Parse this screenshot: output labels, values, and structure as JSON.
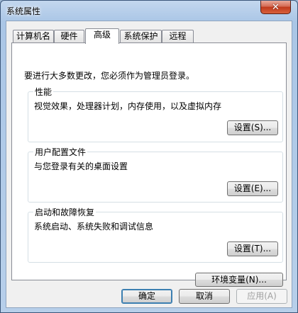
{
  "window": {
    "title": "系统属性"
  },
  "tabs": [
    {
      "label": "计算机名"
    },
    {
      "label": "硬件"
    },
    {
      "label": "高级"
    },
    {
      "label": "系统保护"
    },
    {
      "label": "远程"
    }
  ],
  "admin_note": "要进行大多数更改，您必须作为管理员登录。",
  "groups": {
    "performance": {
      "caption": "性能",
      "desc": "视觉效果，处理器计划，内存使用，以及虚拟内存",
      "button": "设置(S)..."
    },
    "user_profiles": {
      "caption": "用户配置文件",
      "desc": "与您登录有关的桌面设置",
      "button": "设置(E)..."
    },
    "startup_recovery": {
      "caption": "启动和故障恢复",
      "desc": "系统启动、系统失败和调试信息",
      "button": "设置(T)..."
    }
  },
  "env_button": "环境变量(N)...",
  "footer": {
    "ok": "确定",
    "cancel": "取消",
    "apply": "应用(A)"
  },
  "icons": {
    "close": "close-icon"
  },
  "colors": {
    "title_bar": "#aac6e6",
    "close_button": "#c0391c",
    "dialog": "#f0f0f0"
  }
}
